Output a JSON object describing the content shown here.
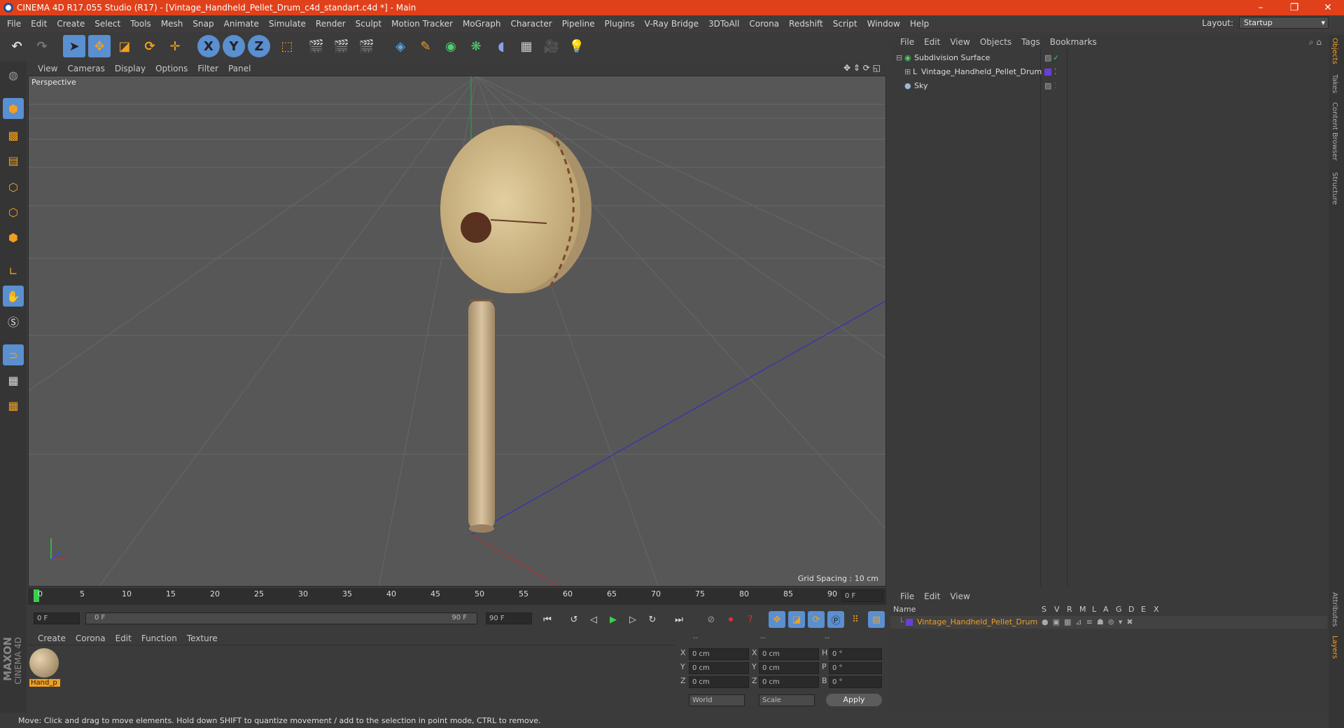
{
  "window": {
    "title": "CINEMA 4D R17.055 Studio (R17) - [Vintage_Handheld_Pellet_Drum_c4d_standart.c4d *] - Main",
    "minimize": "–",
    "maximize": "❐",
    "close": "✕"
  },
  "menubar": {
    "items": [
      "File",
      "Edit",
      "Create",
      "Select",
      "Tools",
      "Mesh",
      "Snap",
      "Animate",
      "Simulate",
      "Render",
      "Sculpt",
      "Motion Tracker",
      "MoGraph",
      "Character",
      "Pipeline",
      "Plugins",
      "V-Ray Bridge",
      "3DToAll",
      "Corona",
      "Redshift",
      "Script",
      "Window",
      "Help"
    ],
    "layout_label": "Layout:",
    "layout_value": "Startup"
  },
  "toolbar": {
    "axis_x": "X",
    "axis_y": "Y",
    "axis_z": "Z"
  },
  "viewport": {
    "menu": [
      "View",
      "Cameras",
      "Display",
      "Options",
      "Filter",
      "Panel"
    ],
    "label": "Perspective",
    "grid_spacing": "Grid Spacing : 10 cm"
  },
  "timeline": {
    "ticks": [
      "0",
      "5",
      "10",
      "15",
      "20",
      "25",
      "30",
      "35",
      "40",
      "45",
      "50",
      "55",
      "60",
      "65",
      "70",
      "75",
      "80",
      "85",
      "90"
    ],
    "frame_field": "0 F",
    "start_field": "0 F",
    "range_start": "0 F",
    "range_end": "90 F",
    "end_field": "90 F"
  },
  "material_panel": {
    "menu": [
      "Create",
      "Corona",
      "Edit",
      "Function",
      "Texture"
    ],
    "material_name": "Hand_p"
  },
  "coords_panel": {
    "headers": [
      "--",
      "--",
      "--"
    ],
    "rows": [
      {
        "a": "X",
        "av": "0 cm",
        "b": "X",
        "bv": "0 cm",
        "c": "H",
        "cv": "0 °"
      },
      {
        "a": "Y",
        "av": "0 cm",
        "b": "Y",
        "bv": "0 cm",
        "c": "P",
        "cv": "0 °"
      },
      {
        "a": "Z",
        "av": "0 cm",
        "b": "Z",
        "bv": "0 cm",
        "c": "B",
        "cv": "0 °"
      }
    ],
    "world": "World",
    "scale": "Scale",
    "apply": "Apply"
  },
  "status": {
    "text": "Move: Click and drag to move elements. Hold down SHIFT to quantize movement / add to the selection in point mode, CTRL to remove."
  },
  "object_manager": {
    "menu": [
      "File",
      "Edit",
      "View",
      "Objects",
      "Tags",
      "Bookmarks"
    ],
    "objects": [
      {
        "name": "Subdivision Surface"
      },
      {
        "name": "Vintage_Handheld_Pellet_Drum"
      },
      {
        "name": "Sky"
      }
    ]
  },
  "layer_manager": {
    "menu": [
      "File",
      "Edit",
      "View"
    ],
    "columns": [
      "Name",
      "S",
      "V",
      "R",
      "M",
      "L",
      "A",
      "G",
      "D",
      "E",
      "X"
    ],
    "layers": [
      {
        "name": "Vintage_Handheld_Pellet_Drum"
      }
    ]
  },
  "right_tabs": [
    "Objects",
    "Takes",
    "Content Browser",
    "Structure",
    "Attributes",
    "Layers"
  ],
  "brand": {
    "maxon": "MAXON",
    "c4d": "CINEMA 4D"
  },
  "colors": {
    "title_bar": "#e0401a",
    "accent_orange": "#f0a020",
    "layer_color": "#6a3fd8",
    "selected_blue": "#5a8fd0"
  }
}
